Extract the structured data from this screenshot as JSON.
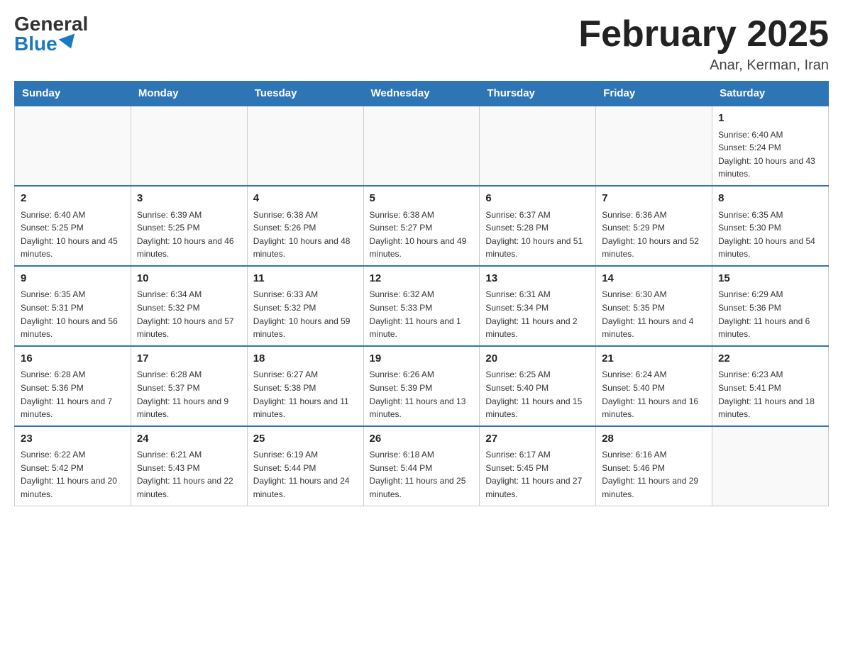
{
  "header": {
    "logo_general": "General",
    "logo_blue": "Blue",
    "month_title": "February 2025",
    "location": "Anar, Kerman, Iran"
  },
  "days_of_week": [
    "Sunday",
    "Monday",
    "Tuesday",
    "Wednesday",
    "Thursday",
    "Friday",
    "Saturday"
  ],
  "weeks": [
    [
      {
        "day": "",
        "sunrise": "",
        "sunset": "",
        "daylight": ""
      },
      {
        "day": "",
        "sunrise": "",
        "sunset": "",
        "daylight": ""
      },
      {
        "day": "",
        "sunrise": "",
        "sunset": "",
        "daylight": ""
      },
      {
        "day": "",
        "sunrise": "",
        "sunset": "",
        "daylight": ""
      },
      {
        "day": "",
        "sunrise": "",
        "sunset": "",
        "daylight": ""
      },
      {
        "day": "",
        "sunrise": "",
        "sunset": "",
        "daylight": ""
      },
      {
        "day": "1",
        "sunrise": "Sunrise: 6:40 AM",
        "sunset": "Sunset: 5:24 PM",
        "daylight": "Daylight: 10 hours and 43 minutes."
      }
    ],
    [
      {
        "day": "2",
        "sunrise": "Sunrise: 6:40 AM",
        "sunset": "Sunset: 5:25 PM",
        "daylight": "Daylight: 10 hours and 45 minutes."
      },
      {
        "day": "3",
        "sunrise": "Sunrise: 6:39 AM",
        "sunset": "Sunset: 5:25 PM",
        "daylight": "Daylight: 10 hours and 46 minutes."
      },
      {
        "day": "4",
        "sunrise": "Sunrise: 6:38 AM",
        "sunset": "Sunset: 5:26 PM",
        "daylight": "Daylight: 10 hours and 48 minutes."
      },
      {
        "day": "5",
        "sunrise": "Sunrise: 6:38 AM",
        "sunset": "Sunset: 5:27 PM",
        "daylight": "Daylight: 10 hours and 49 minutes."
      },
      {
        "day": "6",
        "sunrise": "Sunrise: 6:37 AM",
        "sunset": "Sunset: 5:28 PM",
        "daylight": "Daylight: 10 hours and 51 minutes."
      },
      {
        "day": "7",
        "sunrise": "Sunrise: 6:36 AM",
        "sunset": "Sunset: 5:29 PM",
        "daylight": "Daylight: 10 hours and 52 minutes."
      },
      {
        "day": "8",
        "sunrise": "Sunrise: 6:35 AM",
        "sunset": "Sunset: 5:30 PM",
        "daylight": "Daylight: 10 hours and 54 minutes."
      }
    ],
    [
      {
        "day": "9",
        "sunrise": "Sunrise: 6:35 AM",
        "sunset": "Sunset: 5:31 PM",
        "daylight": "Daylight: 10 hours and 56 minutes."
      },
      {
        "day": "10",
        "sunrise": "Sunrise: 6:34 AM",
        "sunset": "Sunset: 5:32 PM",
        "daylight": "Daylight: 10 hours and 57 minutes."
      },
      {
        "day": "11",
        "sunrise": "Sunrise: 6:33 AM",
        "sunset": "Sunset: 5:32 PM",
        "daylight": "Daylight: 10 hours and 59 minutes."
      },
      {
        "day": "12",
        "sunrise": "Sunrise: 6:32 AM",
        "sunset": "Sunset: 5:33 PM",
        "daylight": "Daylight: 11 hours and 1 minute."
      },
      {
        "day": "13",
        "sunrise": "Sunrise: 6:31 AM",
        "sunset": "Sunset: 5:34 PM",
        "daylight": "Daylight: 11 hours and 2 minutes."
      },
      {
        "day": "14",
        "sunrise": "Sunrise: 6:30 AM",
        "sunset": "Sunset: 5:35 PM",
        "daylight": "Daylight: 11 hours and 4 minutes."
      },
      {
        "day": "15",
        "sunrise": "Sunrise: 6:29 AM",
        "sunset": "Sunset: 5:36 PM",
        "daylight": "Daylight: 11 hours and 6 minutes."
      }
    ],
    [
      {
        "day": "16",
        "sunrise": "Sunrise: 6:28 AM",
        "sunset": "Sunset: 5:36 PM",
        "daylight": "Daylight: 11 hours and 7 minutes."
      },
      {
        "day": "17",
        "sunrise": "Sunrise: 6:28 AM",
        "sunset": "Sunset: 5:37 PM",
        "daylight": "Daylight: 11 hours and 9 minutes."
      },
      {
        "day": "18",
        "sunrise": "Sunrise: 6:27 AM",
        "sunset": "Sunset: 5:38 PM",
        "daylight": "Daylight: 11 hours and 11 minutes."
      },
      {
        "day": "19",
        "sunrise": "Sunrise: 6:26 AM",
        "sunset": "Sunset: 5:39 PM",
        "daylight": "Daylight: 11 hours and 13 minutes."
      },
      {
        "day": "20",
        "sunrise": "Sunrise: 6:25 AM",
        "sunset": "Sunset: 5:40 PM",
        "daylight": "Daylight: 11 hours and 15 minutes."
      },
      {
        "day": "21",
        "sunrise": "Sunrise: 6:24 AM",
        "sunset": "Sunset: 5:40 PM",
        "daylight": "Daylight: 11 hours and 16 minutes."
      },
      {
        "day": "22",
        "sunrise": "Sunrise: 6:23 AM",
        "sunset": "Sunset: 5:41 PM",
        "daylight": "Daylight: 11 hours and 18 minutes."
      }
    ],
    [
      {
        "day": "23",
        "sunrise": "Sunrise: 6:22 AM",
        "sunset": "Sunset: 5:42 PM",
        "daylight": "Daylight: 11 hours and 20 minutes."
      },
      {
        "day": "24",
        "sunrise": "Sunrise: 6:21 AM",
        "sunset": "Sunset: 5:43 PM",
        "daylight": "Daylight: 11 hours and 22 minutes."
      },
      {
        "day": "25",
        "sunrise": "Sunrise: 6:19 AM",
        "sunset": "Sunset: 5:44 PM",
        "daylight": "Daylight: 11 hours and 24 minutes."
      },
      {
        "day": "26",
        "sunrise": "Sunrise: 6:18 AM",
        "sunset": "Sunset: 5:44 PM",
        "daylight": "Daylight: 11 hours and 25 minutes."
      },
      {
        "day": "27",
        "sunrise": "Sunrise: 6:17 AM",
        "sunset": "Sunset: 5:45 PM",
        "daylight": "Daylight: 11 hours and 27 minutes."
      },
      {
        "day": "28",
        "sunrise": "Sunrise: 6:16 AM",
        "sunset": "Sunset: 5:46 PM",
        "daylight": "Daylight: 11 hours and 29 minutes."
      },
      {
        "day": "",
        "sunrise": "",
        "sunset": "",
        "daylight": ""
      }
    ]
  ]
}
